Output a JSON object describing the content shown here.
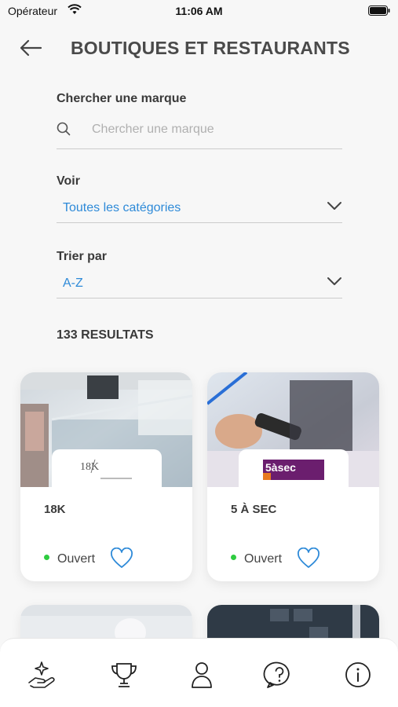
{
  "status_bar": {
    "carrier": "Opérateur",
    "time": "11:06 AM"
  },
  "header": {
    "title": "BOUTIQUES ET RESTAURANTS"
  },
  "search": {
    "label": "Chercher une marque",
    "placeholder": "Chercher une marque",
    "value": ""
  },
  "filter_voir": {
    "label": "Voir",
    "value": "Toutes les catégories"
  },
  "filter_trier": {
    "label": "Trier par",
    "value": "A-Z"
  },
  "results": {
    "count_label": "133 RESULTATS"
  },
  "cards": [
    {
      "name": "18K",
      "status": "Ouvert",
      "logo_text": "18K"
    },
    {
      "name": "5 À SEC",
      "status": "Ouvert",
      "logo_text": "5àsec"
    }
  ],
  "colors": {
    "accent": "#2e8ad8",
    "open_dot": "#2ecc40",
    "logo_5asec_bg": "#6b1e6e"
  },
  "tabbar": {
    "items": [
      "offers-icon",
      "trophy-icon",
      "profile-icon",
      "help-icon",
      "info-icon"
    ]
  }
}
